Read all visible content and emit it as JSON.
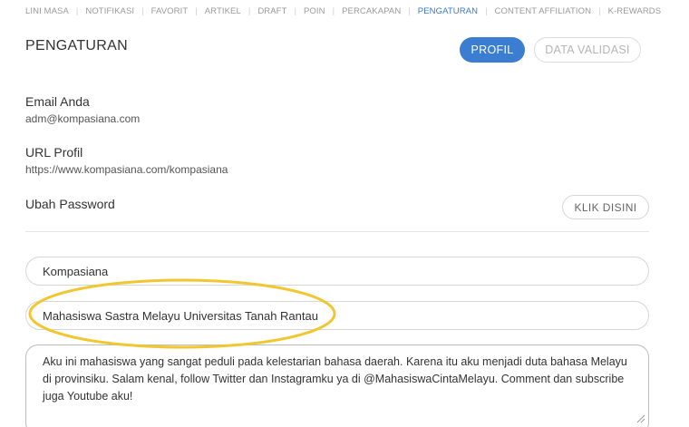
{
  "nav": {
    "items": [
      {
        "label": "LINI MASA",
        "active": false
      },
      {
        "label": "NOTIFIKASI",
        "active": false
      },
      {
        "label": "FAVORIT",
        "active": false
      },
      {
        "label": "ARTIKEL",
        "active": false
      },
      {
        "label": "DRAFT",
        "active": false
      },
      {
        "label": "POIN",
        "active": false
      },
      {
        "label": "PERCAKAPAN",
        "active": false
      },
      {
        "label": "PENGATURAN",
        "active": true
      },
      {
        "label": "CONTENT AFFILIATION",
        "active": false
      },
      {
        "label": "K-REWARDS",
        "active": false
      }
    ]
  },
  "page": {
    "title": "PENGATURAN",
    "profil_label": "PROFIL",
    "validasi_label": "DATA VALIDASI"
  },
  "account": {
    "email_label": "Email Anda",
    "email_value": "adm@kompasiana.com",
    "url_label": "URL Profil",
    "url_value": "https://www.kompasiana.com/kompasiana",
    "password_label": "Ubah Password",
    "password_button": "KLIK DISINI"
  },
  "form": {
    "name_value": "Kompasiana",
    "tagline_value": "Mahasiswa Sastra Melayu Universitas Tanah Rantau",
    "bio_value": "Aku ini mahasiswa yang sangat peduli pada kelestarian bahasa daerah. Karena itu aku menjadi duta bahasa Melayu di provinsiku. Salam kenal, follow Twitter dan Instagramku ya di @MahasiswaCintaMelayu. Comment dan subscribe juga Youtube aku!"
  },
  "colors": {
    "accent": "#3b7dd1",
    "active_nav": "#3b78c9",
    "highlight": "#f2c62f"
  }
}
